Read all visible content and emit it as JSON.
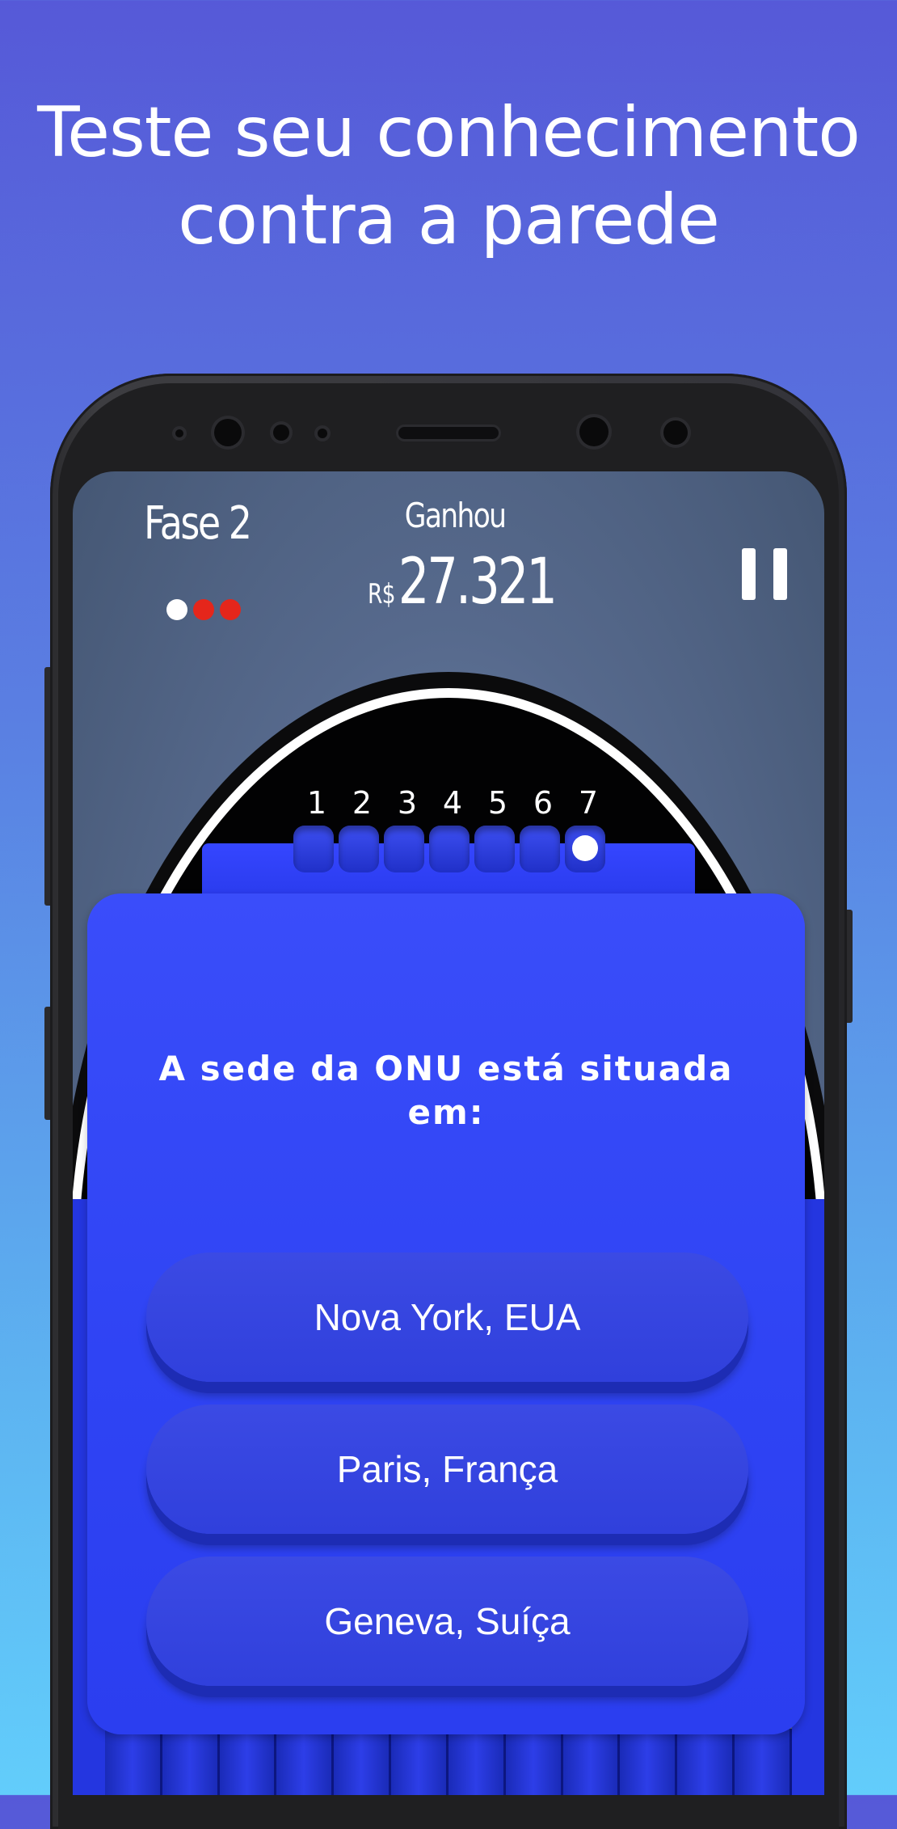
{
  "headline": {
    "line1": "Teste seu conhecimento",
    "line2": "contra a parede"
  },
  "hud": {
    "phase": "Fase 2",
    "lives": [
      {
        "color": "#ffffff"
      },
      {
        "color": "#e5261b"
      },
      {
        "color": "#e5261b"
      }
    ],
    "won_label": "Ganhou",
    "currency": "R$",
    "amount": "27.321"
  },
  "board": {
    "slot_numbers": [
      "1",
      "2",
      "3",
      "4",
      "5",
      "6",
      "7"
    ],
    "puck_slot": "7"
  },
  "quiz": {
    "question": "A sede da ONU está situada em:",
    "answers": [
      "Nova York, EUA",
      "Paris, França",
      "Geneva, Suíça"
    ]
  },
  "colors": {
    "accent": "#2f44f4",
    "life_lost": "#e5261b"
  }
}
